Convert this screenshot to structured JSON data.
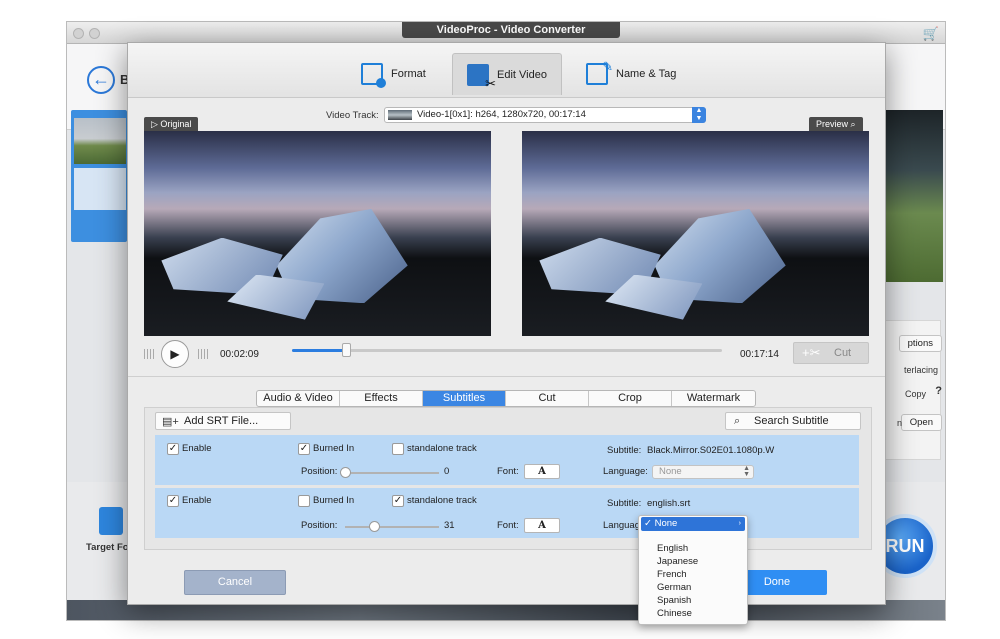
{
  "app": {
    "title": "VideoProc - Video Converter",
    "back_label": "B",
    "target_format_label": "Target For",
    "run_label": "RUN",
    "side_options_label": "ptions",
    "side_interlacing_label": "terlacing",
    "side_copy_label": "Copy",
    "side_help_label": "?",
    "side_open_label": "Open",
    "side_n_label": "n"
  },
  "dialog": {
    "tabs": [
      {
        "label": "Format",
        "icon": "format-icon"
      },
      {
        "label": "Edit Video",
        "icon": "edit-video-icon"
      },
      {
        "label": "Name & Tag",
        "icon": "name-tag-icon"
      }
    ],
    "active_tab": "Edit Video",
    "video_track_label": "Video Track:",
    "video_track_value": "Video-1[0x1]: h264, 1280x720, 00:17:14",
    "original_label": "Original",
    "preview_label": "Preview",
    "current_time": "00:02:09",
    "total_time": "00:17:14",
    "progress_percent": 12.5,
    "cut_label": "Cut",
    "edit_tabs": [
      "Audio & Video",
      "Effects",
      "Subtitles",
      "Cut",
      "Crop",
      "Watermark"
    ],
    "active_edit_tab": "Subtitles",
    "add_srt_label": "Add SRT File...",
    "search_subtitle_label": "Search Subtitle",
    "subtitles": [
      {
        "enable_label": "Enable",
        "enable_checked": "✓",
        "burned_label": "Burned In",
        "burned_checked": "✓",
        "standalone_label": "standalone track",
        "standalone_checked": "",
        "position_label": "Position:",
        "position_value": "0",
        "position_fraction": 0.0,
        "font_label": "Font:",
        "font_button": "A",
        "subtitle_label": "Subtitle:",
        "subtitle_file": "Black.Mirror.S02E01.1080p.W",
        "language_label": "Language:",
        "language_value": "None"
      },
      {
        "enable_label": "Enable",
        "enable_checked": "✓",
        "burned_label": "Burned In",
        "burned_checked": "",
        "standalone_label": "standalone track",
        "standalone_checked": "✓",
        "position_label": "Position:",
        "position_value": "31",
        "position_fraction": 0.31,
        "font_label": "Font:",
        "font_button": "A",
        "subtitle_label": "Subtitle:",
        "subtitle_file": "english.srt",
        "language_label": "Language",
        "language_value": "None"
      }
    ],
    "cancel_label": "Cancel",
    "done_label": "Done"
  },
  "dropdown": {
    "selected": "None",
    "check": "✓",
    "options": [
      "English",
      "Japanese",
      "French",
      "German",
      "Spanish",
      "Chinese"
    ]
  },
  "colors": {
    "accent": "#3b86e3",
    "row_bg": "#bad8f5",
    "done_bg": "#2f8ef3",
    "cancel_bg": "#a4b3cb"
  }
}
